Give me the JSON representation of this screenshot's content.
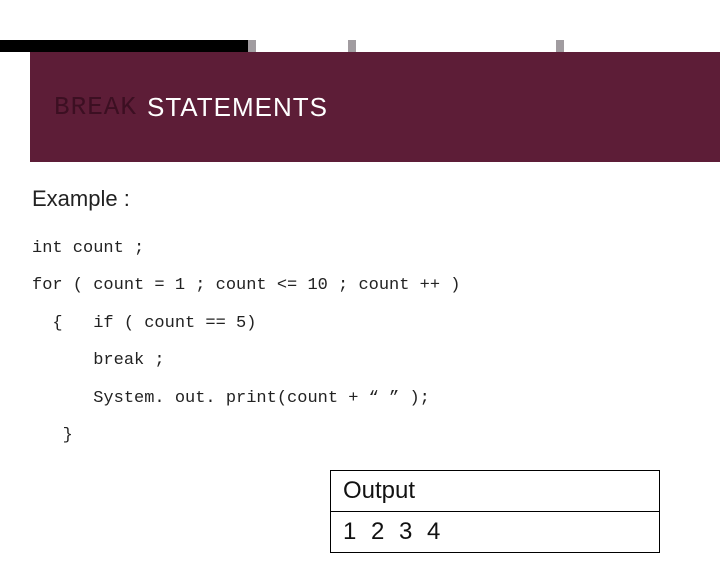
{
  "title": {
    "keyword": "BREAK",
    "rest": "STATEMENTS"
  },
  "example_label": "Example :",
  "code": {
    "line1": "int count ;",
    "line2": "for ( count = 1 ; count <= 10 ; count ++ )",
    "line3": "  {   if ( count == 5)",
    "line4": "      break ;",
    "line5": "      System. out. print(count + “ ” );",
    "line6": "   }"
  },
  "output": {
    "label": "Output",
    "values": "1 2 3 4"
  },
  "colors": {
    "banner": "#5d1d37",
    "accent_gray": "#a19ca0"
  }
}
